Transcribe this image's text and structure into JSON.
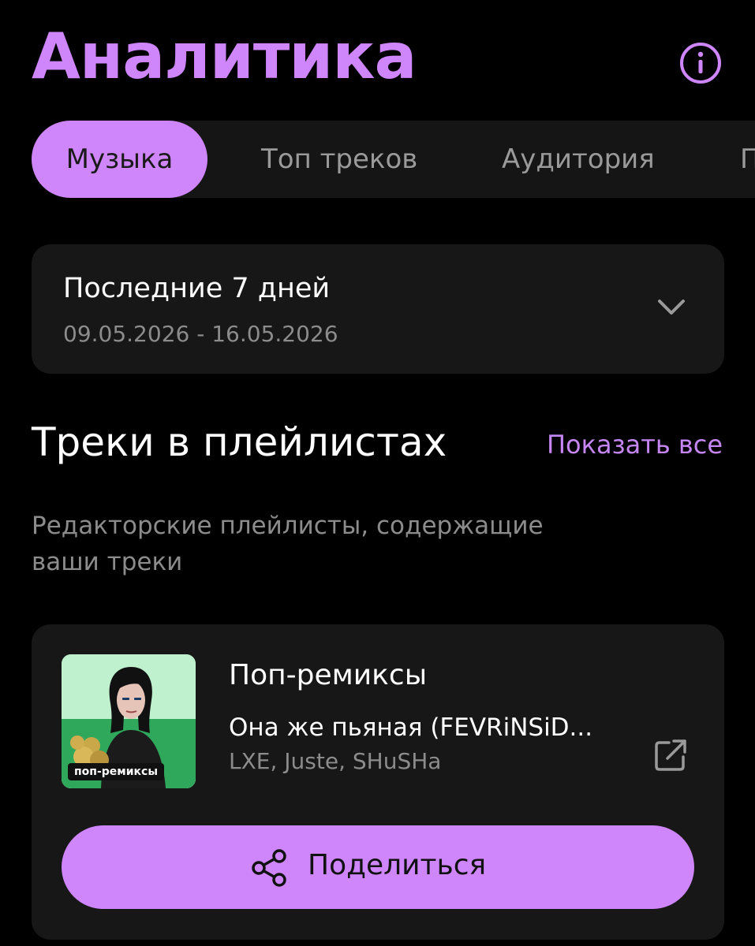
{
  "header": {
    "title": "Аналитика",
    "info_icon": "info-circle-icon"
  },
  "tabs": [
    {
      "label": "Музыка",
      "active": true
    },
    {
      "label": "Топ треков",
      "active": false
    },
    {
      "label": "Аудитория",
      "active": false
    },
    {
      "label": "П",
      "active": false
    }
  ],
  "period": {
    "title": "Последние 7 дней",
    "range": "09.05.2026 - 16.05.2026",
    "icon": "chevron-down-icon"
  },
  "playlists_section": {
    "title": "Треки в плейлистах",
    "show_all": "Показать все",
    "description": "Редакторские плейлисты, содержащие ваши треки"
  },
  "playlist_card": {
    "cover_tag": "поп-ремиксы",
    "name": "Поп-ремиксы",
    "track": "Она же пьяная (FEVRiNSiD...",
    "artists": "LXE, Juste, SHuSHa",
    "link_icon": "external-link-icon",
    "share_label": "Поделиться",
    "share_icon": "share-icon"
  },
  "colors": {
    "accent": "#cf86fb",
    "background": "#000000",
    "card": "#171717",
    "muted_text": "#8c8c8c"
  }
}
